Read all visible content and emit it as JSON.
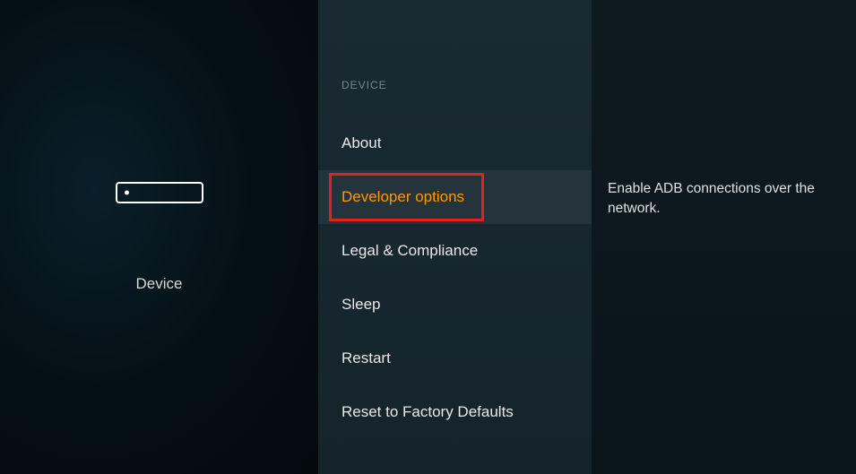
{
  "left": {
    "label": "Device"
  },
  "middle": {
    "section_header": "DEVICE",
    "items": [
      {
        "label": "About",
        "selected": false
      },
      {
        "label": "Developer options",
        "selected": true
      },
      {
        "label": "Legal & Compliance",
        "selected": false
      },
      {
        "label": "Sleep",
        "selected": false
      },
      {
        "label": "Restart",
        "selected": false
      },
      {
        "label": "Reset to Factory Defaults",
        "selected": false
      }
    ]
  },
  "right": {
    "description": "Enable ADB connections over the network."
  },
  "colors": {
    "accent": "#ff9900",
    "highlight": "#e32020"
  }
}
